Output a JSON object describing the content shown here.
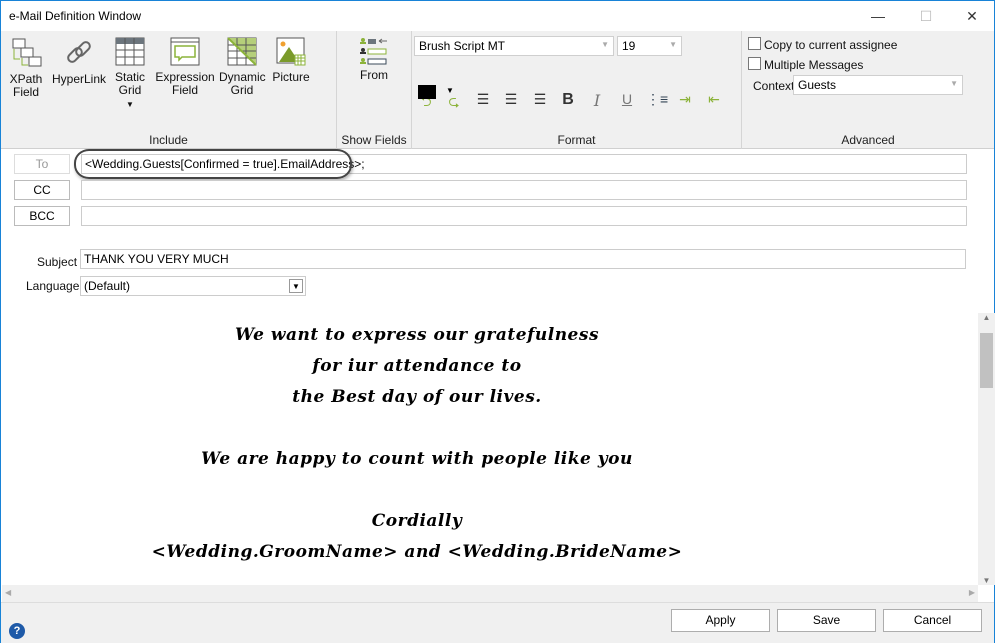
{
  "window": {
    "title": "e-Mail Definition Window",
    "minimize": "—",
    "maximize": "☐",
    "close": "✕"
  },
  "ribbon": {
    "include": {
      "label": "Include",
      "buttons": [
        {
          "label1": "XPath",
          "label2": "Field",
          "icon": "xpath-field-icon"
        },
        {
          "label1": "HyperLink",
          "label2": "",
          "icon": "link-icon"
        },
        {
          "label1": "Static",
          "label2": "Grid",
          "icon": "grid-icon"
        },
        {
          "label1": "Expression",
          "label2": "Field",
          "icon": "expression-icon"
        },
        {
          "label1": "Dynamic",
          "label2": "Grid",
          "icon": "dynamic-grid-icon"
        },
        {
          "label1": "Picture",
          "label2": "",
          "icon": "picture-icon"
        }
      ]
    },
    "show_fields": {
      "label": "Show Fields",
      "from": "From"
    },
    "format": {
      "label": "Format",
      "font": "Brush Script MT",
      "size": "19",
      "text_color": "#000000"
    },
    "advanced": {
      "label": "Advanced",
      "copy_assignee": "Copy to current assignee",
      "multiple_messages": "Multiple Messages",
      "context_label": "Context",
      "context_value": "Guests"
    }
  },
  "address": {
    "to_label": "To",
    "to_value": "<Wedding.Guests[Confirmed = true].EmailAddress>;",
    "cc_label": "CC",
    "cc_value": "",
    "bcc_label": "BCC",
    "bcc_value": ""
  },
  "subject": {
    "label": "Subject",
    "value": "THANK YOU VERY MUCH"
  },
  "language": {
    "label": "Language:",
    "value": "(Default)"
  },
  "body": {
    "lines": [
      "We want to express our gratefulness",
      "for iur attendance to",
      "the Best day of our lives.",
      "We are happy to count with people like you",
      "Cordially",
      "<Wedding.GroomName> and <Wedding.BrideName>"
    ]
  },
  "footer": {
    "help": "?",
    "apply": "Apply",
    "save": "Save",
    "cancel": "Cancel"
  },
  "colors": {
    "accent_green": "#8cb33a",
    "border_blue": "#1883d7"
  }
}
